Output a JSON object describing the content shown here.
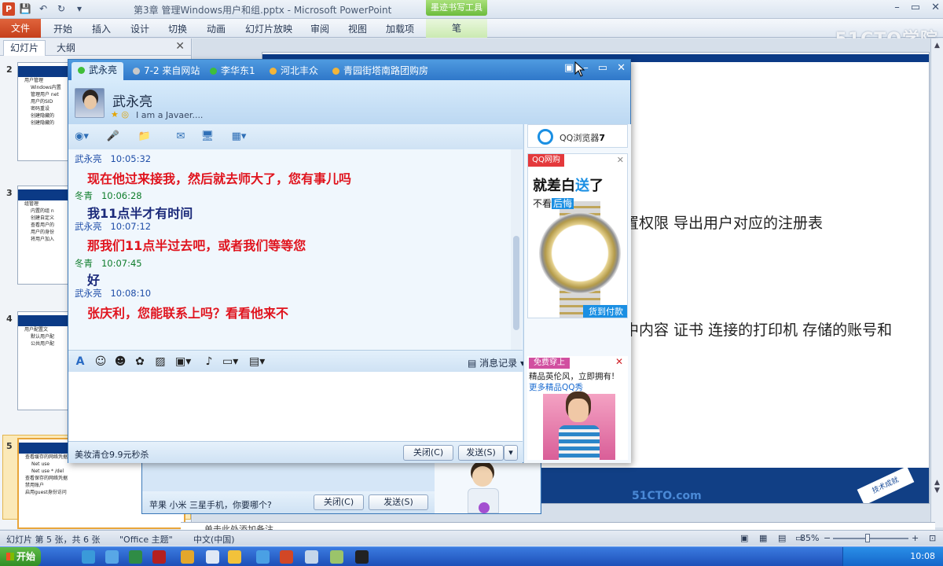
{
  "ppt": {
    "app_icon": "P",
    "title": "第3章 管理Windows用户和组.pptx - Microsoft PowerPoint",
    "context_tab": "墨迹书写工具",
    "context_subtab": "笔",
    "file_tab": "文件",
    "tabs": [
      "开始",
      "插入",
      "设计",
      "切换",
      "动画",
      "幻灯片放映",
      "审阅",
      "视图",
      "加载项"
    ],
    "watermark": "51CTO学院"
  },
  "panel": {
    "tabs": [
      "幻灯片",
      "大纲"
    ],
    "close": "✕",
    "thumbnails": [
      {
        "num": "2",
        "title": "用户管理",
        "lines": [
          "Windows内置",
          "管理用户 net",
          "用户的SID",
          "密码重设",
          "创建隐藏的",
          "创建隐藏的"
        ]
      },
      {
        "num": "3",
        "title": "组管理",
        "lines": [
          "内置的组 n",
          "创建自定义",
          "查看用户的",
          "用户的身份",
          "将用户加入"
        ]
      },
      {
        "num": "4",
        "title": "用户配置文",
        "lines": [
          "默认用户配",
          "公共用户配"
        ]
      },
      {
        "num": "5",
        "title": "查看缓存的网络凭据",
        "lines": [
          "Net use",
          "Net use * /del",
          "查看保存的网络凭据",
          "禁用账户",
          "启用guest身份访问"
        ]
      }
    ]
  },
  "slide": {
    "line1": "置权限  导出用户对应的注册表",
    "line2": "中内容  证书  连接的打印机  存储的账号和",
    "footer_logo": "51CTO.com",
    "footer_badge": "技术成就"
  },
  "notes": "单击此处添加备注",
  "status": {
    "slide_count": "幻灯片 第 5 张，共 6 张",
    "theme": "\"Office 主题\"",
    "language": "中文(中国)",
    "zoom": "85%",
    "zoom_minus": "−",
    "zoom_plus": "+"
  },
  "taskbar": {
    "start": "开始",
    "clock": "10:08"
  },
  "qq": {
    "tabs": [
      {
        "label": "武永亮",
        "status": "online"
      },
      {
        "label": "7-2 来自网站",
        "status": "offline"
      },
      {
        "label": "李华东1",
        "status": "online"
      },
      {
        "label": "河北丰众",
        "status": "group"
      },
      {
        "label": "青园街塔南路团购房",
        "status": "group"
      }
    ],
    "contact_name": "武永亮",
    "signature": "I am a Javaer....",
    "messages": [
      {
        "sender": "武永亮",
        "time": "10:05:32",
        "text": "现在他过来接我，然后就去师大了，您有事儿吗",
        "self": true
      },
      {
        "sender": "冬青",
        "time": "10:06:28",
        "text": "我11点半才有时间",
        "self": false
      },
      {
        "sender": "武永亮",
        "time": "10:07:12",
        "text": "那我们11点半过去吧，或者我们等等您",
        "self": true
      },
      {
        "sender": "冬青",
        "time": "10:07:45",
        "text": "好",
        "self": false
      },
      {
        "sender": "武永亮",
        "time": "10:08:10",
        "text": "张庆利，您能联系上吗？看看他来不",
        "self": true
      }
    ],
    "history_label": "消息记录",
    "bottom_ad": "美妆清仓9.9元秒杀",
    "close_button": "关闭(C)",
    "send_button": "发送(S)",
    "browser_ad": {
      "label": "QQ浏览器",
      "version": "7"
    },
    "watch_ad": {
      "badge": "QQ网购",
      "headline_a": "就差白",
      "headline_b": "送",
      "headline_c": "了",
      "sub_a": "不看",
      "sub_b": "后悔",
      "cta": "货到付款"
    },
    "avatar_ad": {
      "badge": "免费穿上",
      "line1": "精品英伦风，立即拥有!",
      "line2": "更多精品QQ秀"
    }
  },
  "qq_back": {
    "ad": "苹果 小米 三星手机，你要哪个?",
    "close_button": "关闭(C)",
    "send_button": "发送(S)"
  }
}
